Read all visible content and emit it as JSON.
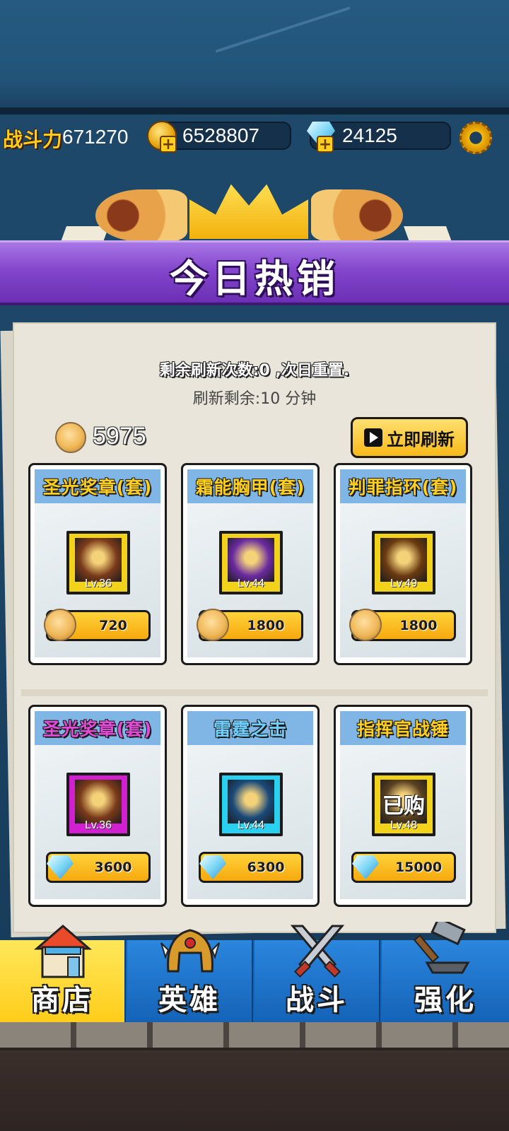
{
  "resources": {
    "power_label": "战斗力",
    "power_value": "671270",
    "gold": "6528807",
    "gems": "24125"
  },
  "banner": {
    "title": "今日热销"
  },
  "shop": {
    "refresh_count_text": "剩余刷新次数:0 ,次日重置.",
    "refresh_timer_text": "刷新剩余:10 分钟",
    "token_balance": "5975",
    "refresh_button": "立即刷新"
  },
  "items": [
    {
      "name": "圣光奖章(套)",
      "level": "Lv.36",
      "price": "720",
      "currency": "token-icon",
      "title_color": "#ffcf1d",
      "frame_color": "#f2d21a",
      "bg": "#7a3a1a"
    },
    {
      "name": "霜能胸甲(套)",
      "level": "Lv.44",
      "price": "1800",
      "currency": "token-icon",
      "title_color": "#ffcf1d",
      "frame_color": "#f2d21a",
      "bg": "#6a2aa0"
    },
    {
      "name": "判罪指环(套)",
      "level": "Lv.49",
      "price": "1800",
      "currency": "token-icon",
      "title_color": "#ffcf1d",
      "frame_color": "#f2d21a",
      "bg": "#6a3a10"
    },
    {
      "name": "圣光奖章(套)",
      "level": "Lv.36",
      "price": "3600",
      "currency": "gem-icon",
      "title_color": "#e24ad8",
      "frame_color": "#d020d0",
      "bg": "#7a3a1a"
    },
    {
      "name": "雷霆之击",
      "level": "Lv.44",
      "price": "6300",
      "currency": "gem-icon",
      "title_color": "#6fd0ff",
      "frame_color": "#2ad0f0",
      "bg": "#1a4a7a"
    },
    {
      "name": "指挥官战锤",
      "level": "Lv.48",
      "price": "15000",
      "currency": "gem-icon",
      "title_color": "#ffcf1d",
      "frame_color": "#f2d21a",
      "bg": "#5a4020",
      "status": "已购"
    }
  ],
  "nav": {
    "shop": "商店",
    "heroes": "英雄",
    "battle": "战斗",
    "upgrade": "强化"
  },
  "colors": {
    "banner": "#8346cc",
    "active_tab": "#ffd21a",
    "tab": "#1664b8"
  }
}
